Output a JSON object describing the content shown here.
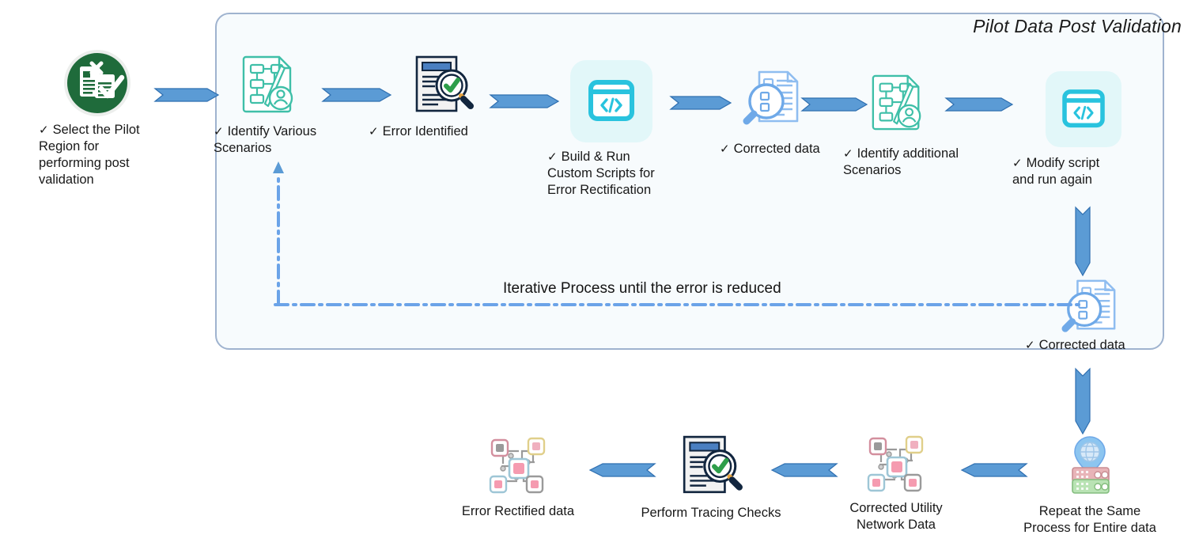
{
  "diagram": {
    "title": "Pilot Data Post Validation",
    "iterative_note": "Iterative Process until the error is reduced",
    "colors": {
      "panel_border": "#9fb3cf",
      "panel_fill": "#f7fbfd",
      "arrow_blue": "#4a90d9",
      "arrow_blue_fill": "#5b9bd5",
      "dash_blue": "#6ba3e8",
      "icon_green": "#1f6b3b",
      "icon_teal": "#3fc0bf",
      "icon_cyan": "#29c3de",
      "icon_lightblue": "#9fc6f0",
      "icon_navy": "#12263f",
      "text": "#181818"
    }
  },
  "steps": {
    "select_pilot": {
      "label": "Select the Pilot\nRegion for\nperforming post\nvalidation",
      "tick": "✓",
      "icon": "document-check-circle-icon"
    },
    "identify_scenarios": {
      "label": "Identify  Various\nScenarios",
      "tick": "✓",
      "icon": "flowchart-user-icon"
    },
    "error_identified": {
      "label": "Error Identified",
      "tick": "✓",
      "icon": "document-magnifier-check-icon"
    },
    "build_run_scripts": {
      "label": "Build & Run\nCustom Scripts for\nError Rectification",
      "tick": "✓",
      "icon": "code-window-icon"
    },
    "corrected_data_1": {
      "label": "Corrected data",
      "tick": "✓",
      "icon": "checklist-magnifier-icon"
    },
    "identify_additional": {
      "label": "Identify additional\nScenarios",
      "tick": "✓",
      "icon": "flowchart-user-icon"
    },
    "modify_script": {
      "label": "Modify script\nand run again",
      "tick": "✓",
      "icon": "code-window-icon"
    },
    "corrected_data_2": {
      "label": "Corrected data",
      "tick": "✓",
      "icon": "checklist-magnifier-icon"
    },
    "repeat_entire": {
      "label": "Repeat the Same\nProcess for Entire data",
      "tick": "",
      "icon": "globe-pin-server-icon"
    },
    "corrected_utility": {
      "label": "Corrected Utility\nNetwork Data",
      "tick": "",
      "icon": "network-nodes-icon"
    },
    "tracing_checks": {
      "label": "Perform Tracing Checks",
      "tick": "",
      "icon": "document-magnifier-check-icon"
    },
    "error_rectified": {
      "label": "Error Rectified data",
      "tick": "",
      "icon": "network-nodes-icon"
    }
  }
}
